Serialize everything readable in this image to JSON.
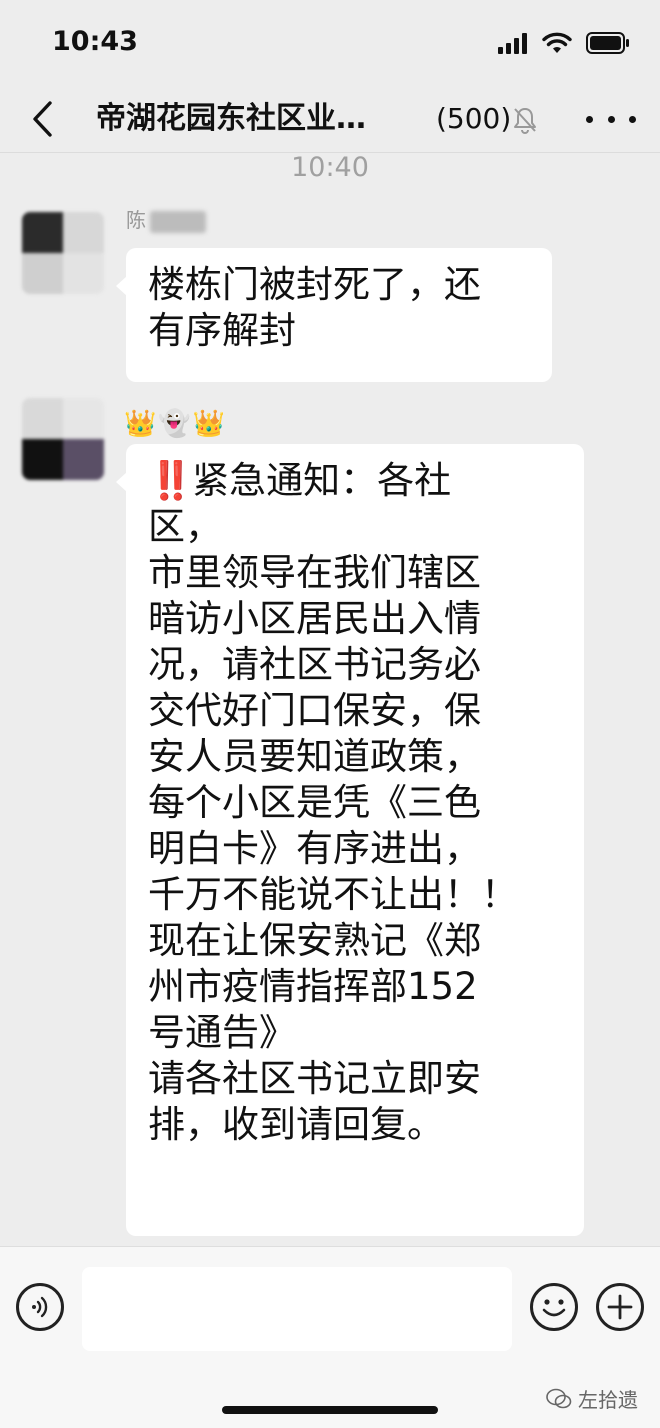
{
  "status_bar": {
    "time": "10:43"
  },
  "nav": {
    "title": "帝湖花园东社区业…",
    "member_count": "(500)"
  },
  "chat": {
    "timestamp": "10:40",
    "messages": [
      {
        "sender_prefix": "陈",
        "text": "楼栋门被封死了，还\n有序解封"
      },
      {
        "sender_emoji": "👑👻👑",
        "alert": "‼️",
        "text": "紧急通知：各社\n区，\n市里领导在我们辖区\n暗访小区居民出入情\n况，请社区书记务必\n交代好门口保安，保\n安人员要知道政策，\n每个小区是凭《三色\n明白卡》有序进出，\n千万不能说不让出！！\n现在让保安熟记《郑\n州市疫情指挥部152\n号通告》\n请各社区书记立即安\n排，收到请回复。"
      }
    ]
  },
  "input": {
    "placeholder": ""
  },
  "watermark": {
    "text": "左拾遗"
  },
  "icons": [
    "signal-icon",
    "wifi-icon",
    "battery-icon",
    "back-icon",
    "mute-bell-icon",
    "more-icon",
    "voice-icon",
    "emoji-icon",
    "plus-icon",
    "wechat-watermark-icon"
  ]
}
